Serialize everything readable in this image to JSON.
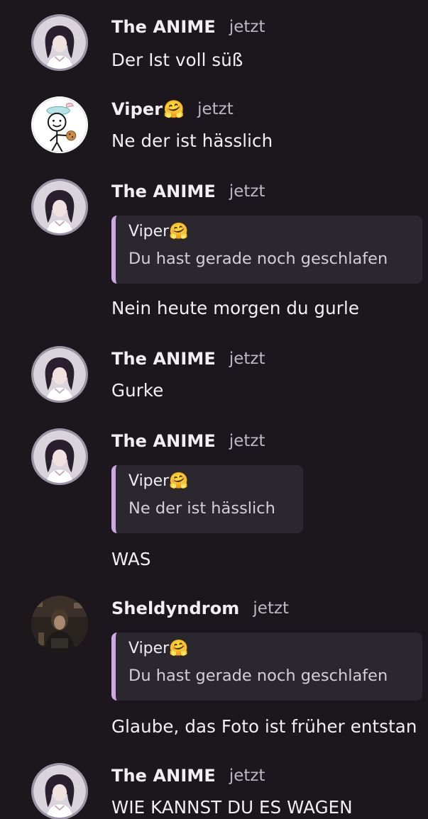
{
  "messages": [
    {
      "author": "The ANIME",
      "author_emoji": "",
      "time": "jetzt",
      "avatar": "anime-avatar",
      "text": "Der Ist voll süß"
    },
    {
      "author": "Viper",
      "author_emoji": "🤗",
      "time": "jetzt",
      "avatar": "stickman-avatar",
      "text": "Ne der ist hässlich"
    },
    {
      "author": "The ANIME",
      "author_emoji": "",
      "time": "jetzt",
      "avatar": "anime-avatar",
      "reply": {
        "author": "Viper",
        "author_emoji": "🤗",
        "text": "Du hast gerade noch geschlafen"
      },
      "text": "Nein heute morgen du gurle"
    },
    {
      "author": "The ANIME",
      "author_emoji": "",
      "time": "jetzt",
      "avatar": "anime-avatar",
      "text": "Gurke"
    },
    {
      "author": "The ANIME",
      "author_emoji": "",
      "time": "jetzt",
      "avatar": "anime-avatar",
      "reply": {
        "author": "Viper",
        "author_emoji": "🤗",
        "text": "Ne der ist hässlich"
      },
      "text": "WAS"
    },
    {
      "author": "Sheldyndrom",
      "author_emoji": "",
      "time": "jetzt",
      "avatar": "photo-avatar",
      "reply": {
        "author": "Viper",
        "author_emoji": "🤗",
        "text": "Du hast gerade noch geschlafen"
      },
      "text": "Glaube, das Foto ist früher entstan"
    },
    {
      "author": "The ANIME",
      "author_emoji": "",
      "time": "jetzt",
      "avatar": "anime-avatar",
      "text": "WIE KANNST DU ES WAGEN"
    }
  ],
  "colors": {
    "background": "#1b171d",
    "reply_bar": "#cfa6e6",
    "reply_bg": "#2b272f"
  }
}
